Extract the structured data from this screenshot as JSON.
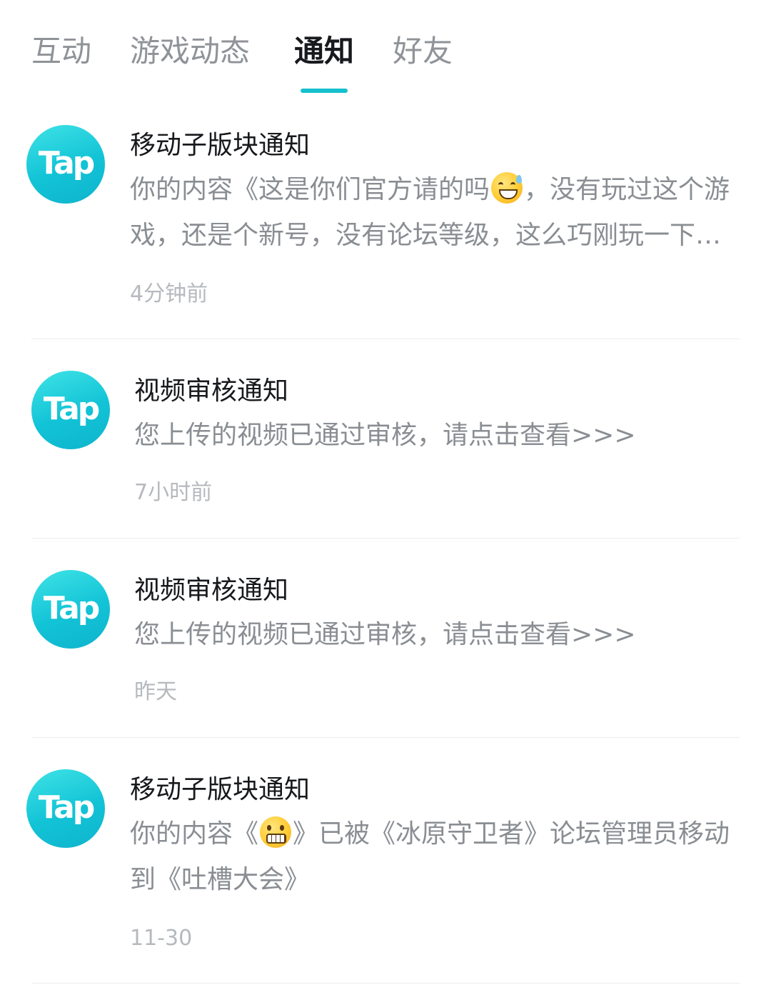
{
  "colors": {
    "accent": "#14c0cc",
    "title_text": "#17191c",
    "body_text": "#8a8e93",
    "time_text": "#b6b9bd"
  },
  "tabs": [
    {
      "label": "互动"
    },
    {
      "label": "游戏动态"
    },
    {
      "label": "通知"
    },
    {
      "label": "好友"
    }
  ],
  "notifications": [
    {
      "avatar_text": "Tap",
      "title": "移动子版块通知",
      "body_before": "你的内容《这是你们官方请的吗",
      "emoji": "grinning-sweat-emoji",
      "body_after": "，没有玩过这个游戏，还是个新号，没有论坛等级，这么巧刚玩一下就遇到了这样的事情",
      "time": "4分钟前"
    },
    {
      "avatar_text": "Tap",
      "title": "视频审核通知",
      "body": "您上传的视频已通过审核，请点击查看>>>",
      "time": "7小时前"
    },
    {
      "avatar_text": "Tap",
      "title": "视频审核通知",
      "body": "您上传的视频已通过审核，请点击查看>>>",
      "time": "昨天"
    },
    {
      "avatar_text": "Tap",
      "title": "移动子版块通知",
      "body_before": "你的内容《",
      "emoji": "grimacing-emoji",
      "body_after": "》已被《冰原守卫者》论坛管理员移动到《吐槽大会》",
      "time": "11-30"
    }
  ]
}
